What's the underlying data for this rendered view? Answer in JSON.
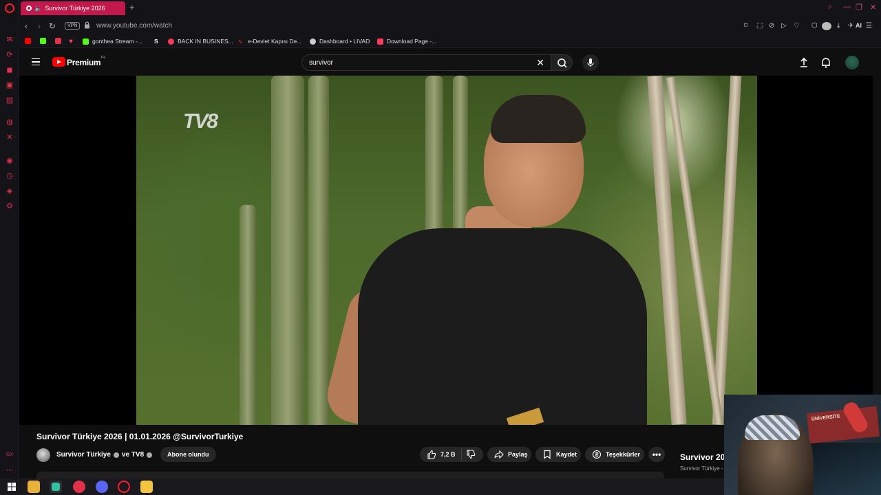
{
  "browser": {
    "tab": {
      "title": "Survivor Türkiye 2026"
    },
    "address": {
      "vpn_label": "VPN",
      "url": "www.youtube.com/watch"
    },
    "ai_label": "AI",
    "bookmarks": [
      {
        "label": "gonthea Stream -...",
        "color": "#53fc18"
      },
      {
        "label": "BACK IN BUSINES...",
        "color": "#ff3b5c"
      },
      {
        "label": "e-Devlet Kapısı De...",
        "color": "#e0304a"
      },
      {
        "label": "Dashboard • LIVAD",
        "color": "#cccccc"
      },
      {
        "label": "Download Page -...",
        "color": "#ff3b5c"
      }
    ]
  },
  "youtube": {
    "brand": "Premium",
    "region": "TR",
    "search": {
      "query": "survivor"
    },
    "video": {
      "watermark": "TV8",
      "title": "Survivor Türkiye 2026 | 01.01.2026 @SurvivorTurkiye",
      "channel": "Survivor Türkiye",
      "channel_and": "ve TV8",
      "subscribe_label": "Abone olundu",
      "likes": "7,2 B",
      "share_label": "Paylaş",
      "save_label": "Kaydet",
      "thanks_label": "Teşekkürler"
    },
    "side_card": {
      "title": "Survivor 20",
      "channel": "Survivor Türkiye -"
    }
  },
  "webcam": {
    "sign_text": "ÜNİVERSİTE"
  },
  "colors": {
    "accent": "#c2184b",
    "yt_red": "#ff0000",
    "opera_red": "#ff1b2d"
  }
}
